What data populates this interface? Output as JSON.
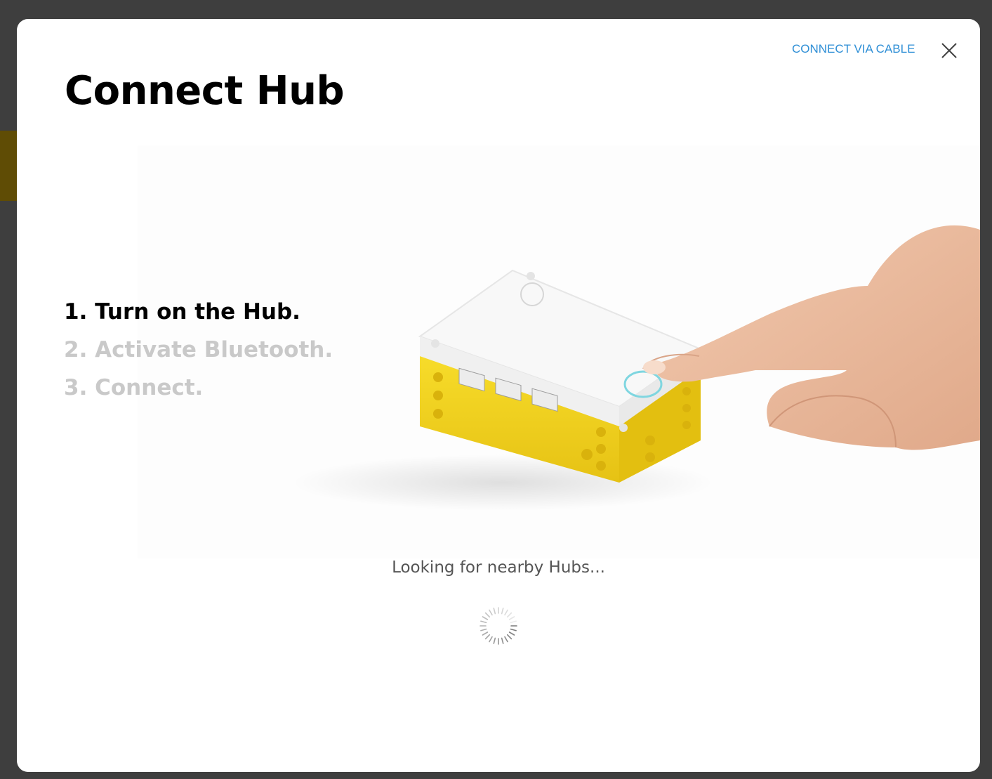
{
  "modal": {
    "title": "Connect Hub",
    "connect_via_cable": "CONNECT VIA CABLE",
    "close_icon": "close-icon"
  },
  "steps": [
    {
      "label": "1. Turn on the Hub.",
      "active": true
    },
    {
      "label": "2. Activate Bluetooth.",
      "active": false
    },
    {
      "label": "3. Connect.",
      "active": false
    }
  ],
  "status": {
    "text": "Looking for nearby Hubs...",
    "spinner_icon": "loading-spinner-icon"
  },
  "colors": {
    "link": "#2f8fd6",
    "hub_yellow": "#f5d41c",
    "hub_white": "#f7f7f7",
    "inactive_step": "#c9c9c9",
    "backdrop": "#3e3e3e"
  }
}
